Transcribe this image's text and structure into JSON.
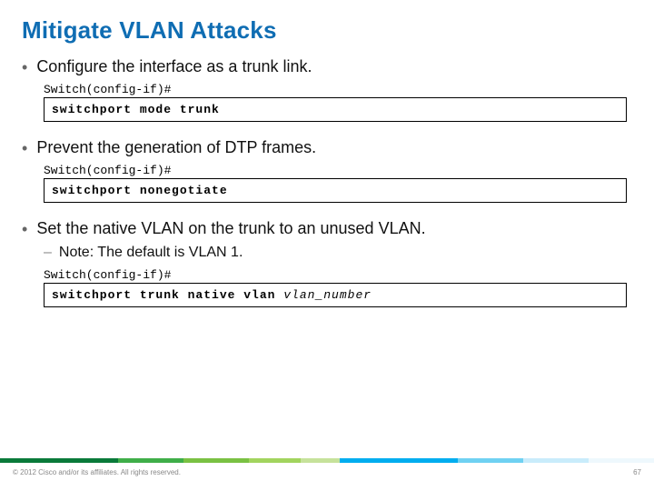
{
  "title": {
    "text": "Mitigate VLAN Attacks",
    "color": "#0f6db3"
  },
  "bullets": [
    {
      "text": "Configure the interface as a trunk link.",
      "prompt": "Switch(config-if)#",
      "command": "switchport mode trunk"
    },
    {
      "text": "Prevent the generation of DTP frames.",
      "prompt": "Switch(config-if)#",
      "command": "switchport nonegotiate"
    },
    {
      "text": "Set the native VLAN on the trunk to an unused VLAN.",
      "sub": "Note: The default is VLAN 1.",
      "prompt": "Switch(config-if)#",
      "command": "switchport trunk native vlan ",
      "command_arg": "vlan_number"
    }
  ],
  "footer": {
    "copyright": "© 2012 Cisco and/or its affiliates. All rights reserved.",
    "page": "67"
  }
}
